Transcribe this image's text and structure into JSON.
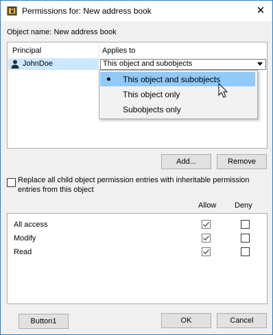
{
  "window": {
    "title": "Permissions for: New address book",
    "close_glyph": "✕",
    "icon": "lock-book-icon"
  },
  "object_name_label": "Object name: New address book",
  "principals": {
    "headers": {
      "principal": "Principal",
      "applies_to": "Applies to"
    },
    "rows": [
      {
        "principal": "JohnDoe",
        "applies_to": "This object and subobjects"
      }
    ]
  },
  "applies_dropdown": {
    "options": [
      "This object and subobjects",
      "This object only",
      "Subobjects only"
    ],
    "selected_index": 0,
    "hovered_index": 0
  },
  "buttons": {
    "add": "Add...",
    "remove": "Remove",
    "button1": "Button1",
    "ok": "OK",
    "cancel": "Cancel"
  },
  "replace_checkbox": {
    "label": "Replace all child object permission entries with inheritable permission entries from this object",
    "checked": false
  },
  "permissions": {
    "allow_header": "Allow",
    "deny_header": "Deny",
    "rows": [
      {
        "name": "All access",
        "allow": true,
        "deny": false
      },
      {
        "name": "Modify",
        "allow": true,
        "deny": false
      },
      {
        "name": "Read",
        "allow": true,
        "deny": false
      }
    ]
  },
  "colors": {
    "accent_border": "#1883d7",
    "selection": "#cce8ff",
    "dropdown_highlight": "#91c9f7"
  }
}
